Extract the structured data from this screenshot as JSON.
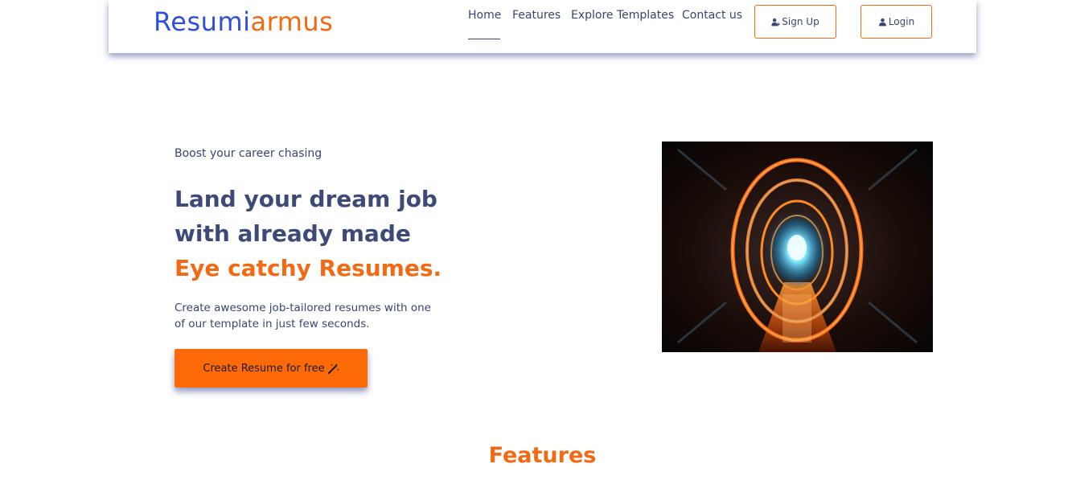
{
  "brand": {
    "part1": "Resumi",
    "part2": "armus",
    "primary_color": "#2f4fd8",
    "accent_color": "#f26a14"
  },
  "nav": {
    "links": [
      {
        "label": "Home",
        "active": true
      },
      {
        "label": "Features"
      },
      {
        "label": "Explore Templates"
      },
      {
        "label": "Contact us"
      }
    ],
    "signup_label": "Sign Up",
    "login_label": "Login",
    "signup_icon": "user-plus-icon",
    "login_icon": "user-icon"
  },
  "hero": {
    "eyebrow": "Boost your career chasing",
    "headline_line1": "Land your dream job",
    "headline_line2": "with already made",
    "headline_accent": "Eye catchy Resumes.",
    "description": "Create awesome job-tailored resumes with one of our template in just few seconds.",
    "cta_label": "Create Resume for free",
    "cta_icon": "magic-wand-icon",
    "cta_color": "#ff6a08",
    "image": "neon-portal-tunnel-image"
  },
  "features": {
    "heading": "Features"
  }
}
